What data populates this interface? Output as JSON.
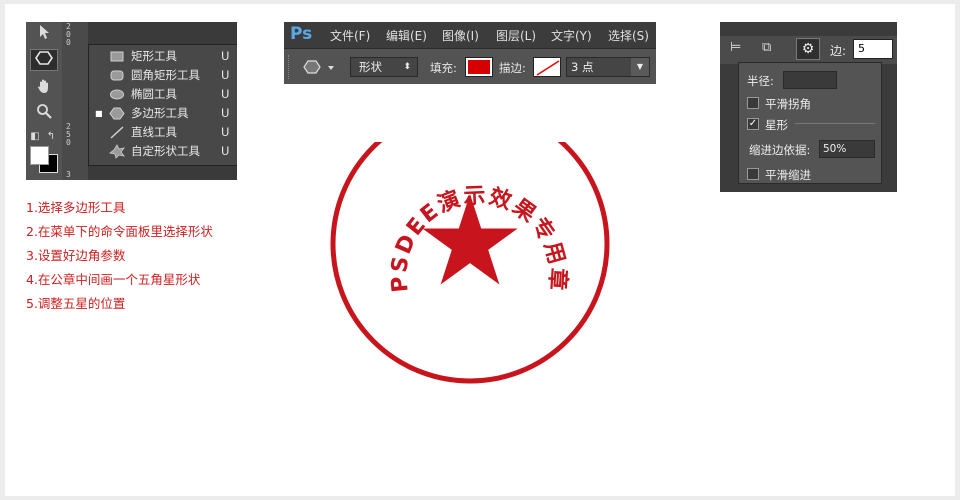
{
  "tools_panel": {
    "toolbar_icons": [
      "move-icon",
      "polygon-tool-icon",
      "hand-icon",
      "zoom-icon",
      "default-colors-icon",
      "swap-colors-icon"
    ],
    "ruler_digits": [
      "2",
      "0",
      "0",
      "2",
      "5",
      "0",
      "3"
    ],
    "flyout": [
      {
        "label": "矩形工具",
        "key": "U",
        "icon": "rectangle-icon",
        "selected": false
      },
      {
        "label": "圆角矩形工具",
        "key": "U",
        "icon": "rounded-rectangle-icon",
        "selected": false
      },
      {
        "label": "椭圆工具",
        "key": "U",
        "icon": "ellipse-icon",
        "selected": false
      },
      {
        "label": "多边形工具",
        "key": "U",
        "icon": "polygon-icon",
        "selected": true
      },
      {
        "label": "直线工具",
        "key": "U",
        "icon": "line-icon",
        "selected": false
      },
      {
        "label": "自定形状工具",
        "key": "U",
        "icon": "custom-shape-icon",
        "selected": false
      }
    ]
  },
  "steps": [
    "1.选择多边形工具",
    "2.在菜单下的命令面板里选择形状",
    "3.设置好边角参数",
    "4.在公章中间画一个五角星形状",
    "5.调整五星的位置"
  ],
  "ps_panel": {
    "logo": "Ps",
    "menu": [
      "文件(F)",
      "编辑(E)",
      "图像(I)",
      "图层(L)",
      "文字(Y)",
      "选择(S)"
    ],
    "mode": "形状",
    "fill_label": "填充:",
    "fill_color": "#d60000",
    "stroke_label": "描边:",
    "stroke_width": "3 点"
  },
  "stamp": {
    "text": "PSDEE演示效果专用章",
    "color": "#c8141c"
  },
  "poly_panel": {
    "sides_label": "边:",
    "sides_value": "5",
    "radius_label": "半径:",
    "radius_value": "",
    "smooth_corners_label": "平滑拐角",
    "smooth_corners_checked": false,
    "star_label": "星形",
    "star_checked": true,
    "indent_label": "缩进边依据:",
    "indent_value": "50%",
    "smooth_indents_label": "平滑缩进",
    "smooth_indents_checked": false
  }
}
